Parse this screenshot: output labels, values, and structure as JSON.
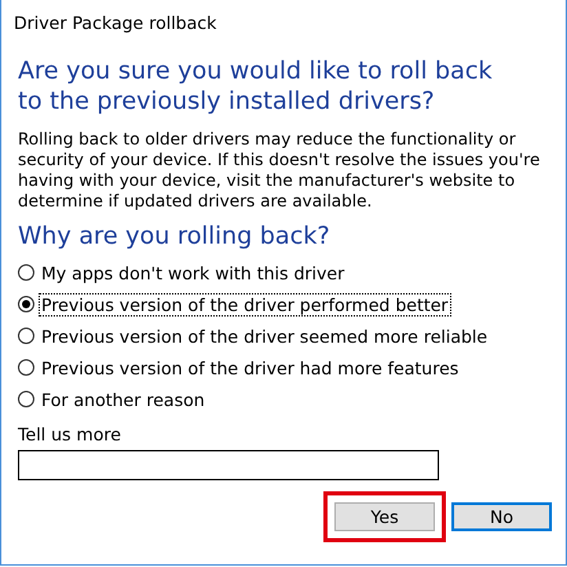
{
  "window": {
    "title": "Driver Package rollback"
  },
  "heading": "Are you sure you would like to roll back to the previously installed drivers?",
  "description": "Rolling back to older drivers may reduce the functionality or security of your device.  If this doesn't resolve the issues you're having with your device, visit the manufacturer's website to determine if updated drivers are available.",
  "reason_heading": "Why are you rolling back?",
  "reasons": [
    {
      "label": "My apps don't work with this driver",
      "selected": false
    },
    {
      "label": "Previous version of the driver performed better",
      "selected": true
    },
    {
      "label": "Previous version of the driver seemed more reliable",
      "selected": false
    },
    {
      "label": "Previous version of the driver had more features",
      "selected": false
    },
    {
      "label": "For another reason",
      "selected": false
    }
  ],
  "more": {
    "label": "Tell us more"
  },
  "buttons": [
    {
      "label": "Yes",
      "default": false,
      "highlighted": true
    },
    {
      "label": "No",
      "default": true,
      "highlighted": false
    }
  ]
}
